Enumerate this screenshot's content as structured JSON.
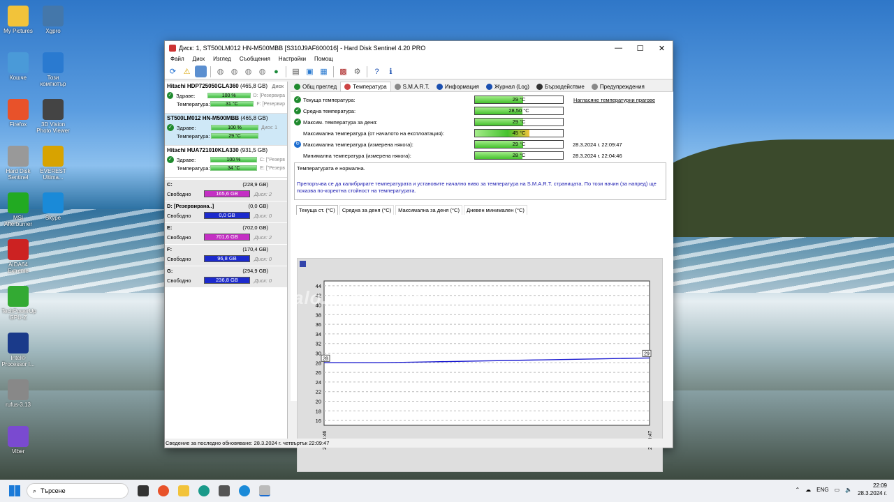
{
  "desktop": {
    "col1": [
      "My Pictures",
      "Кошче",
      "Firefox",
      "Hard Disk Sentinel",
      "MSI Afterburner",
      "AIDA64 Extreme",
      "TechPowerUp GPU-Z",
      "Intel® Processor I...",
      "rufus-3.13",
      "Viber"
    ],
    "col2": [
      "Xgpro",
      "Този компютър",
      "3D Vision Photo Viewer",
      "EVEREST Ultima...",
      "Skype"
    ]
  },
  "window": {
    "title": "Диск: 1, ST500LM012 HN-M500MBB [S310J9AF600016]  -  Hard Disk Sentinel 4.20 PRO",
    "minimize": "—",
    "maximize": "☐",
    "close": "✕"
  },
  "menu": [
    "Файл",
    "Диск",
    "Изглед",
    "Съобщения",
    "Настройки",
    "Помощ"
  ],
  "disks": [
    {
      "name": "Hitachi HDP725050GLA360",
      "size": "(465,8 GB)",
      "side": "Диск",
      "health_label": "Здраве:",
      "health": "100 %",
      "health_side": "D: [Резервира",
      "temp_label": "Температура:",
      "temp": "31 °C",
      "temp_side": "F: [Резервир"
    },
    {
      "name": "ST500LM012 HN-M500MBB",
      "size": "(465,8 GB)",
      "side": "",
      "health_label": "Здраве:",
      "health": "100 %",
      "health_side": "Диск: 1",
      "temp_label": "Температура:",
      "temp": "29 °C",
      "temp_side": ""
    },
    {
      "name": "Hitachi HUA721010KLA330",
      "size": "(931,5 GB)",
      "side": "",
      "health_label": "Здраве:",
      "health": "100 %",
      "health_side": "C: [\"Резерв",
      "temp_label": "Температура:",
      "temp": "34 °C",
      "temp_side": "E: [\"Резерв"
    }
  ],
  "volumes": [
    {
      "name": "C:",
      "size": "(228,9 GB)",
      "free_label": "Свободно",
      "free": "165,6 GB",
      "disk": "Диск: 2",
      "color": "m"
    },
    {
      "name": "D: [Резервирана..]",
      "size": "(0,0 GB)",
      "free_label": "Свободно",
      "free": "0,0 GB",
      "disk": "Диск: 0",
      "color": "b"
    },
    {
      "name": "E:",
      "size": "(702,0 GB)",
      "free_label": "Свободно",
      "free": "701,6 GB",
      "disk": "Диск: 2",
      "color": "m"
    },
    {
      "name": "F:",
      "size": "(170,4 GB)",
      "free_label": "Свободно",
      "free": "96,8 GB",
      "disk": "Диск: 0",
      "color": "b"
    },
    {
      "name": "G:",
      "size": "(294,9 GB)",
      "free_label": "Свободно",
      "free": "236,8 GB",
      "disk": "Диск: 0",
      "color": "b"
    }
  ],
  "tabs": [
    "Общ преглед",
    "Температура",
    "S.M.A.R.T.",
    "Информация",
    "Журнал (Log)",
    "Бързодействие",
    "Предупреждения"
  ],
  "temps": [
    {
      "label": "Текуща температура:",
      "value": "29 °C",
      "fill": 0.55,
      "date": ""
    },
    {
      "label": "Средна температура:",
      "value": "28,50 °C",
      "fill": 0.54,
      "date": ""
    },
    {
      "label": "Максим. температура за деня:",
      "value": "29 °C",
      "fill": 0.55,
      "date": ""
    },
    {
      "label": "Максимална температура (от началото на експлоатация):",
      "value": "45 °C",
      "fill": 0.62,
      "date": ""
    },
    {
      "label": "Максимална температура (измерена някога):",
      "value": "29 °C",
      "fill": 0.55,
      "date": "28.3.2024 г. 22:09:47"
    },
    {
      "label": "Минимална температура (измерена някога):",
      "value": "28 °C",
      "fill": 0.54,
      "date": "28.3.2024 г. 22:04:46"
    }
  ],
  "calibrate_link": "Нагласяне температурни прагове",
  "message": {
    "line1": "Температурата е нормална.",
    "line2": "Препоръчва се да калибрирате температурата и установите начално ниво за температура на S.M.A.R.T. страницата. По този начин (за напред) ще показва по-коректна стойност на температурата."
  },
  "subtabs": [
    "Текуща ст. (°C)",
    "Средна за деня (°C)",
    "Максимална за деня (°C)",
    "Дневен минимален (°C)"
  ],
  "chart_data": {
    "type": "line",
    "x": [
      "22:04:46",
      "22:09:47"
    ],
    "y_ticks": [
      16,
      18,
      20,
      22,
      24,
      26,
      28,
      30,
      32,
      34,
      36,
      38,
      40,
      42,
      44
    ],
    "ylim": [
      15,
      45
    ],
    "series": [
      {
        "values": [
          28,
          28,
          28.2,
          28.4,
          28.6,
          28.8,
          29
        ]
      }
    ],
    "start_label": "28",
    "end_label": "29",
    "line_color": "#1a1ad0"
  },
  "status": "Сведение за последно обновяване: 28.3.2024 г. четвъртък 22:09:47",
  "watermark": "alo.bg/9484816",
  "taskbar": {
    "search": "Търсене",
    "lang": "ENG",
    "time": "22:09",
    "date": "28.3.2024 г."
  }
}
